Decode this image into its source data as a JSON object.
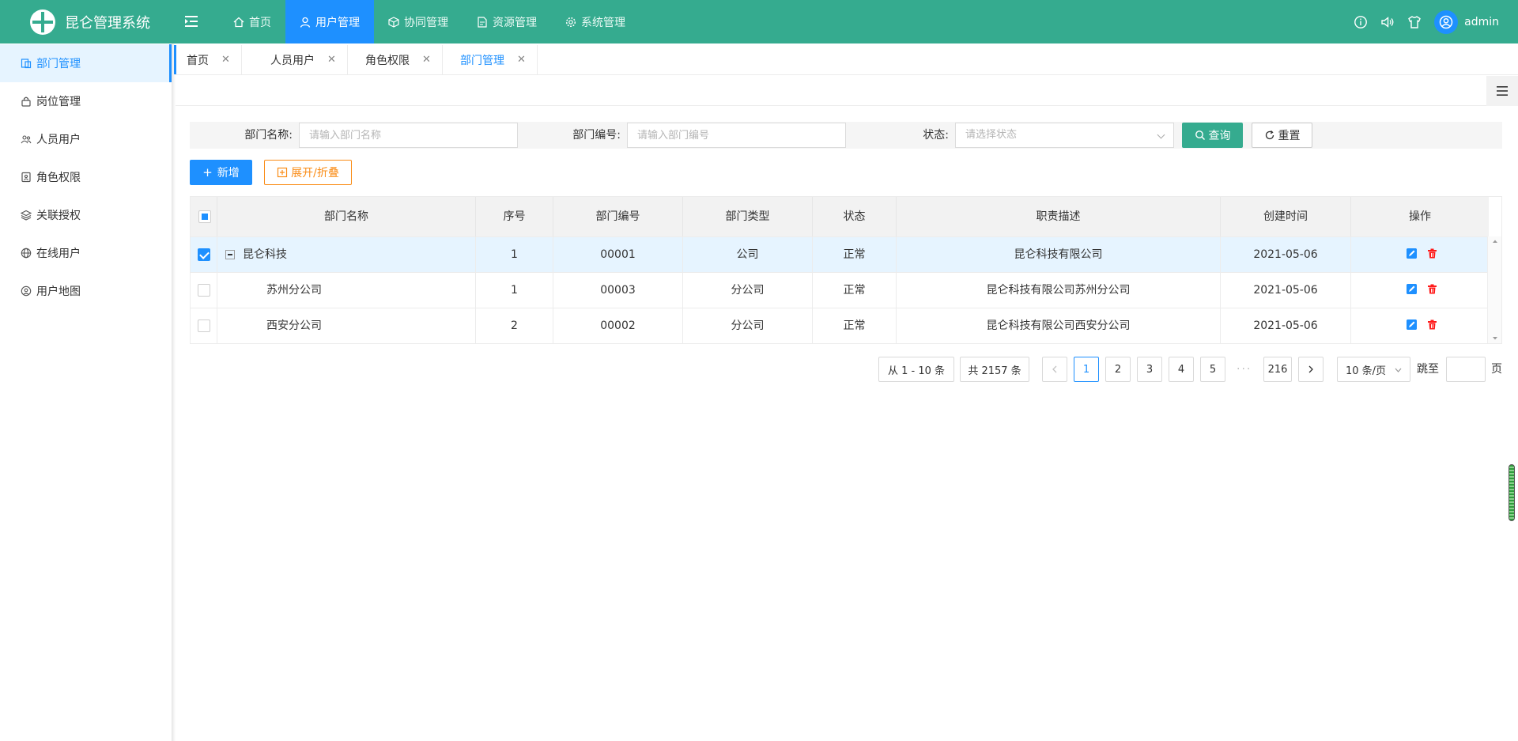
{
  "app": {
    "title": "昆仑管理系统"
  },
  "topnav": [
    {
      "label": "首页",
      "icon": "home-icon",
      "active": false
    },
    {
      "label": "用户管理",
      "icon": "user-icon",
      "active": true
    },
    {
      "label": "协同管理",
      "icon": "cube-icon",
      "active": false
    },
    {
      "label": "资源管理",
      "icon": "document-icon",
      "active": false
    },
    {
      "label": "系统管理",
      "icon": "gear-icon",
      "active": false
    }
  ],
  "user": {
    "name": "admin"
  },
  "sidebar": {
    "items": [
      {
        "label": "部门管理",
        "icon": "department-icon",
        "active": true
      },
      {
        "label": "岗位管理",
        "icon": "lock-icon",
        "active": false
      },
      {
        "label": "人员用户",
        "icon": "people-icon",
        "active": false
      },
      {
        "label": "角色权限",
        "icon": "id-card-icon",
        "active": false
      },
      {
        "label": "关联授权",
        "icon": "layers-icon",
        "active": false
      },
      {
        "label": "在线用户",
        "icon": "globe-icon",
        "active": false
      },
      {
        "label": "用户地图",
        "icon": "map-pin-icon",
        "active": false
      }
    ]
  },
  "tabs": [
    {
      "label": "首页",
      "active": false
    },
    {
      "label": "人员用户",
      "active": false
    },
    {
      "label": "角色权限",
      "active": false
    },
    {
      "label": "部门管理",
      "active": true
    }
  ],
  "search": {
    "name_label": "部门名称:",
    "name_placeholder": "请输入部门名称",
    "code_label": "部门编号:",
    "code_placeholder": "请输入部门编号",
    "status_label": "状态:",
    "status_placeholder": "请选择状态",
    "query_label": "查询",
    "reset_label": "重置"
  },
  "actions": {
    "add_label": "新增",
    "expand_label": "展开/折叠"
  },
  "table": {
    "columns": [
      "部门名称",
      "序号",
      "部门编号",
      "部门类型",
      "状态",
      "职责描述",
      "创建时间",
      "操作"
    ],
    "rows": [
      {
        "checked": true,
        "expanded": true,
        "level": 0,
        "name": "昆仑科技",
        "seq": "1",
        "code": "00001",
        "type": "公司",
        "status": "正常",
        "desc": "昆仑科技有限公司",
        "created": "2021-05-06"
      },
      {
        "checked": false,
        "expanded": false,
        "level": 1,
        "name": "苏州分公司",
        "seq": "1",
        "code": "00003",
        "type": "分公司",
        "status": "正常",
        "desc": "昆仑科技有限公司苏州分公司",
        "created": "2021-05-06"
      },
      {
        "checked": false,
        "expanded": false,
        "level": 1,
        "name": "西安分公司",
        "seq": "2",
        "code": "00002",
        "type": "分公司",
        "status": "正常",
        "desc": "昆仑科技有限公司西安分公司",
        "created": "2021-05-06"
      }
    ]
  },
  "pagination": {
    "range_text": "从 1 - 10 条",
    "total_text": "共 2157 条",
    "pages": [
      "1",
      "2",
      "3",
      "4",
      "5"
    ],
    "current_page": "1",
    "ellipsis": "···",
    "last_page": "216",
    "page_size": "10 条/页",
    "jump_label": "跳至",
    "page_suffix": "页"
  },
  "colors": {
    "primary": "#35ab8f",
    "accent": "#1e90ff",
    "warning": "#fa8c16",
    "danger": "#ff1a1a"
  }
}
